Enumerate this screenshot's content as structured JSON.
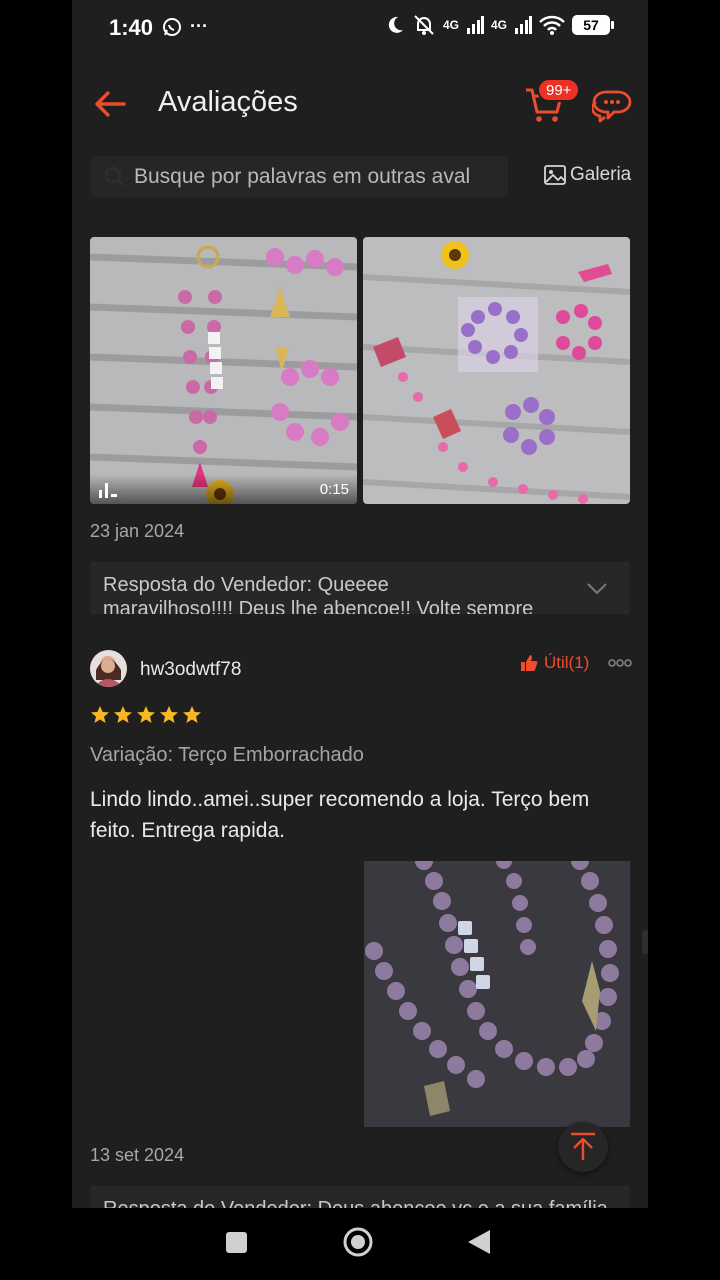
{
  "status": {
    "time": "1:40",
    "battery": "57",
    "network_1": "4G",
    "network_2": "4G"
  },
  "header": {
    "title": "Avaliações",
    "cart_badge": "99+",
    "accent_color": "#ee4d2d"
  },
  "search": {
    "placeholder": "Busque por palavras em outras aval",
    "gallery_label": "Galeria"
  },
  "review1": {
    "video_duration": "0:15",
    "date": "23 jan 2024",
    "seller_reply": "Resposta do Vendedor: Queeee",
    "seller_reply_overflow": "maravilhoso!!!! Deus lhe abençoe!! Volte sempre"
  },
  "review2": {
    "username": "hw3odwtf78",
    "useful_label": "Útil(1)",
    "rating": 5,
    "variation": "Variação: Terço Emborrachado",
    "comment": "Lindo lindo..amei..super recomendo a loja. Terço bem feito. Entrega rapida.",
    "date": "13 set 2024",
    "seller_reply": "Resposta do Vendedor: Deus abençoe vc e a sua família"
  }
}
